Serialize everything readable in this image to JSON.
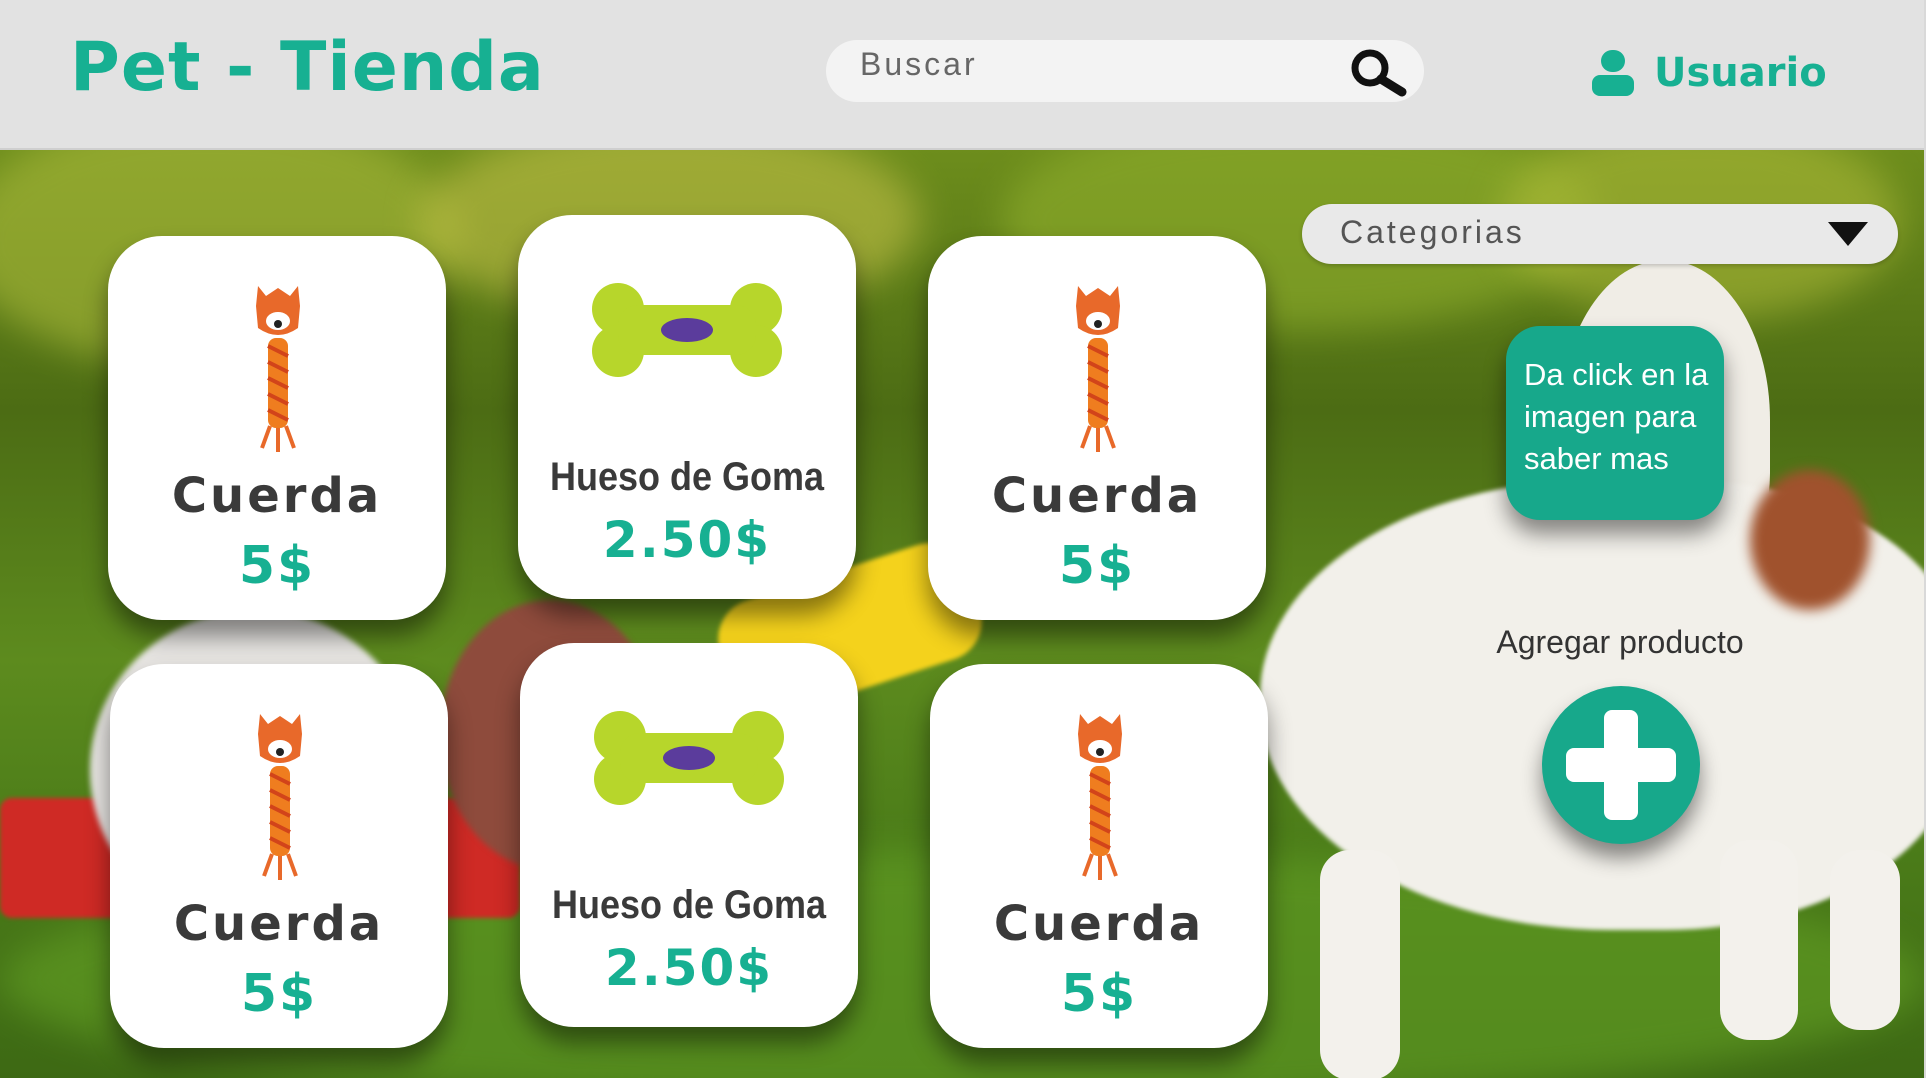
{
  "header": {
    "brand": "Pet - Tienda",
    "search_placeholder": "Buscar",
    "user_label": "Usuario"
  },
  "filters": {
    "categories_label": "Categorias"
  },
  "hint": {
    "text": "Da click en la imagen para saber mas"
  },
  "add_product": {
    "label": "Agregar producto"
  },
  "products": [
    {
      "name": "Cuerda",
      "price": "5$",
      "image": "rope-toy"
    },
    {
      "name": "Hueso de Goma",
      "price": "2.50$",
      "image": "rubber-bone"
    },
    {
      "name": "Cuerda",
      "price": "5$",
      "image": "rope-toy"
    },
    {
      "name": "Cuerda",
      "price": "5$",
      "image": "rope-toy"
    },
    {
      "name": "Hueso de Goma",
      "price": "2.50$",
      "image": "rubber-bone"
    },
    {
      "name": "Cuerda",
      "price": "5$",
      "image": "rope-toy"
    }
  ],
  "colors": {
    "accent": "#17b092",
    "header_bg": "#e2e2e2",
    "card_bg": "#ffffff",
    "text_dark": "#3a3a3a"
  }
}
